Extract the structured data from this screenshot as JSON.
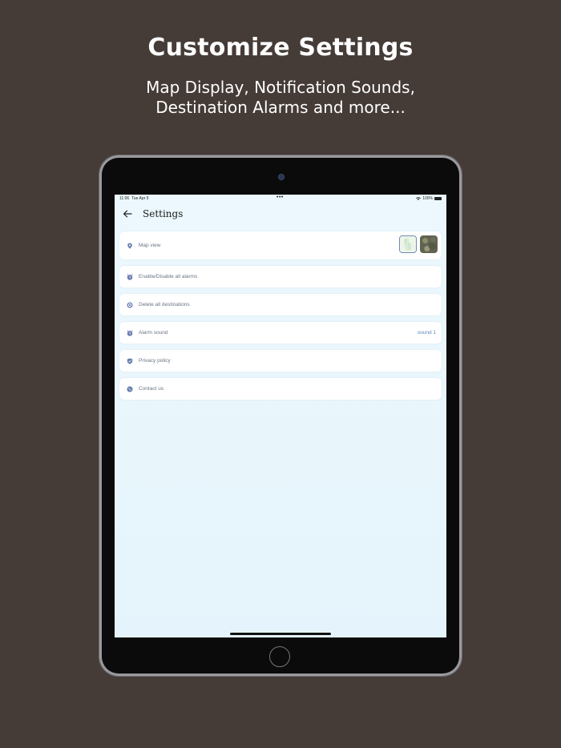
{
  "promo": {
    "headline": "Customize Settings",
    "subline_1": "Map Display, Notification Sounds,",
    "subline_2": "Destination Alarms and more..."
  },
  "status_bar": {
    "time": "11:06",
    "date": "Tue Apr 9",
    "dots": "•••",
    "battery": "100%"
  },
  "app_bar": {
    "title": "Settings",
    "back_icon": "arrow-left-icon"
  },
  "settings": {
    "map_view": {
      "label": "Map view",
      "icon": "location-pin-icon",
      "options": [
        "standard",
        "satellite"
      ],
      "selected": "standard"
    },
    "alarms": {
      "label": "Enable/Disable all alarms",
      "icon": "alarm-icon"
    },
    "destinations": {
      "label": "Delete all destinations",
      "icon": "target-icon"
    },
    "alarm_sound": {
      "label": "Alarm sound",
      "icon": "alarm-icon",
      "value": "sound 1"
    },
    "privacy": {
      "label": "Privacy policy",
      "icon": "shield-icon"
    },
    "contact": {
      "label": "Contact us",
      "icon": "phone-icon"
    }
  },
  "colors": {
    "background": "#453b37",
    "screen": "#e8f6fc",
    "accent": "#5b8ab8",
    "icon": "#6a7fb0"
  }
}
